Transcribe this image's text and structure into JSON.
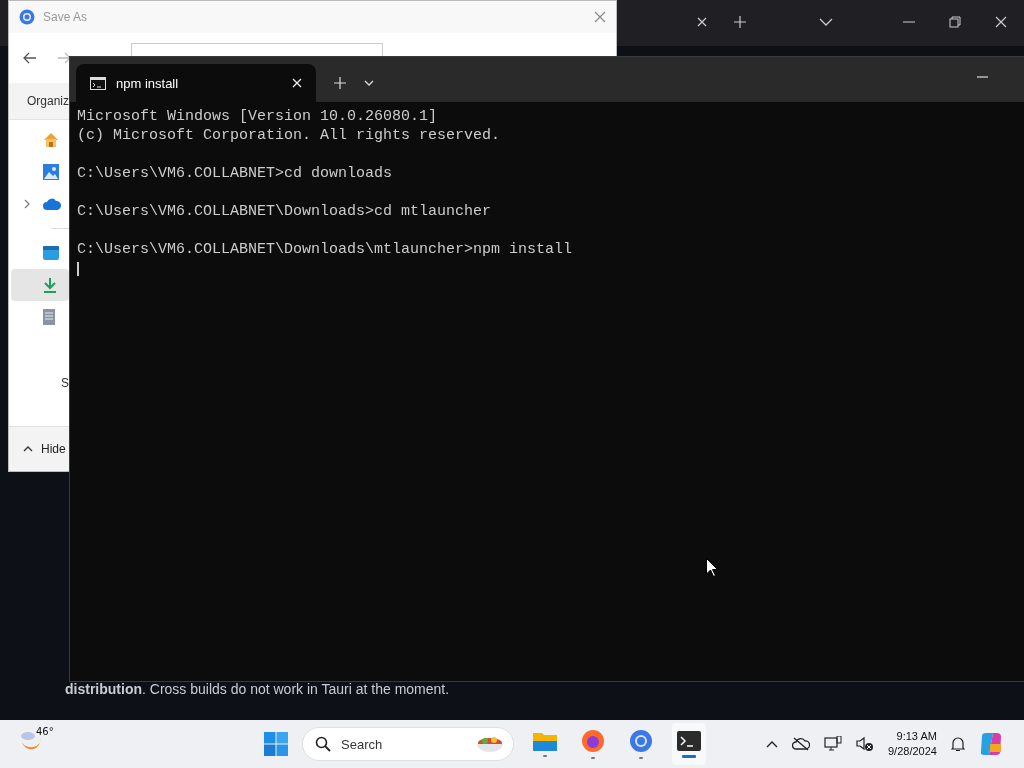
{
  "save_as_dialog": {
    "title": "Save As",
    "toolbar_label": "Organiz",
    "nav_items": [
      {
        "kind": "home",
        "selected": false
      },
      {
        "kind": "gallery",
        "selected": false
      },
      {
        "kind": "cloud",
        "selected": false
      },
      {
        "kind": "desktop",
        "selected": false
      },
      {
        "kind": "download",
        "selected": true
      },
      {
        "kind": "document",
        "selected": false
      }
    ],
    "section_label": "S",
    "footer_toggle": "Hide"
  },
  "browser": {
    "text": "**distribution**. Cross builds do not work in Tauri at the moment."
  },
  "terminal": {
    "tabs": [
      {
        "title": "npm install",
        "selected": true
      }
    ],
    "blocks": [
      [
        "Microsoft Windows [Version 10.0.26080.1]",
        "(c) Microsoft Corporation. All rights reserved."
      ],
      [
        "C:\\Users\\VM6.COLLABNET>cd downloads"
      ],
      [
        "C:\\Users\\VM6.COLLABNET\\Downloads>cd mtlauncher"
      ],
      [
        "C:\\Users\\VM6.COLLABNET\\Downloads\\mtlauncher>npm install"
      ]
    ],
    "cursor": true
  },
  "taskbar": {
    "weather": "46°",
    "search_label": "Search",
    "apps": [
      {
        "kind": "files",
        "active": false
      },
      {
        "kind": "firefox",
        "active": false
      },
      {
        "kind": "chrome",
        "active": false
      },
      {
        "kind": "terminal",
        "active": true
      }
    ],
    "time": "9:13 AM",
    "date": "9/28/2024"
  }
}
